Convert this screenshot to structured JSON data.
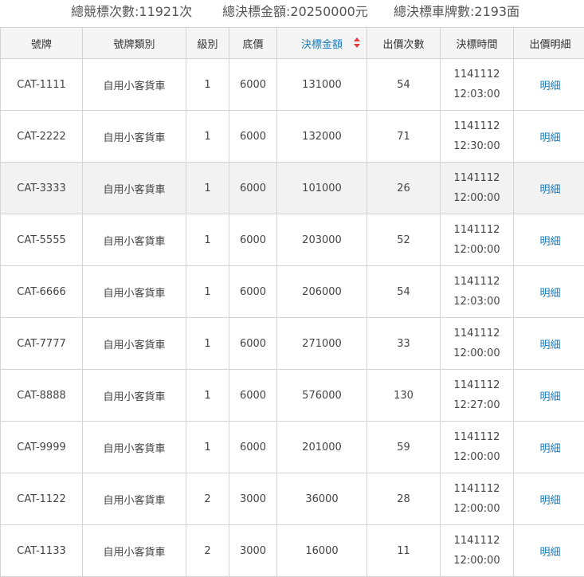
{
  "summary": {
    "total_auctions": "總競標次數:11921次",
    "total_amount": "總決標金額:20250000元",
    "total_plates": "總決標車牌數:2193面"
  },
  "table": {
    "headers": {
      "plate": "號牌",
      "category": "號牌類別",
      "level": "級別",
      "base_price": "底價",
      "final_price": "決標金額",
      "bid_count": "出價次數",
      "close_time": "決標時間",
      "detail": "出價明細"
    },
    "sort": {
      "column": "final_price",
      "icon": "sort-up-down-icon",
      "color": "#e04040"
    },
    "accent_color": "#1a7ab8",
    "rows": [
      {
        "plate": "CAT-1111",
        "category": "自用小客貨車",
        "level": "1",
        "base_price": "6000",
        "final_price": "131000",
        "bid_count": "54",
        "date": "1141112",
        "time": "12:03:00",
        "detail": "明細"
      },
      {
        "plate": "CAT-2222",
        "category": "自用小客貨車",
        "level": "1",
        "base_price": "6000",
        "final_price": "132000",
        "bid_count": "71",
        "date": "1141112",
        "time": "12:30:00",
        "detail": "明細"
      },
      {
        "plate": "CAT-3333",
        "category": "自用小客貨車",
        "level": "1",
        "base_price": "6000",
        "final_price": "101000",
        "bid_count": "26",
        "date": "1141112",
        "time": "12:00:00",
        "detail": "明細"
      },
      {
        "plate": "CAT-5555",
        "category": "自用小客貨車",
        "level": "1",
        "base_price": "6000",
        "final_price": "203000",
        "bid_count": "52",
        "date": "1141112",
        "time": "12:00:00",
        "detail": "明細"
      },
      {
        "plate": "CAT-6666",
        "category": "自用小客貨車",
        "level": "1",
        "base_price": "6000",
        "final_price": "206000",
        "bid_count": "54",
        "date": "1141112",
        "time": "12:03:00",
        "detail": "明細"
      },
      {
        "plate": "CAT-7777",
        "category": "自用小客貨車",
        "level": "1",
        "base_price": "6000",
        "final_price": "271000",
        "bid_count": "33",
        "date": "1141112",
        "time": "12:00:00",
        "detail": "明細"
      },
      {
        "plate": "CAT-8888",
        "category": "自用小客貨車",
        "level": "1",
        "base_price": "6000",
        "final_price": "576000",
        "bid_count": "130",
        "date": "1141112",
        "time": "12:27:00",
        "detail": "明細"
      },
      {
        "plate": "CAT-9999",
        "category": "自用小客貨車",
        "level": "1",
        "base_price": "6000",
        "final_price": "201000",
        "bid_count": "59",
        "date": "1141112",
        "time": "12:00:00",
        "detail": "明細"
      },
      {
        "plate": "CAT-1122",
        "category": "自用小客貨車",
        "level": "2",
        "base_price": "3000",
        "final_price": "36000",
        "bid_count": "28",
        "date": "1141112",
        "time": "12:00:00",
        "detail": "明細"
      },
      {
        "plate": "CAT-1133",
        "category": "自用小客貨車",
        "level": "2",
        "base_price": "3000",
        "final_price": "16000",
        "bid_count": "11",
        "date": "1141112",
        "time": "12:00:00",
        "detail": "明細"
      }
    ]
  }
}
